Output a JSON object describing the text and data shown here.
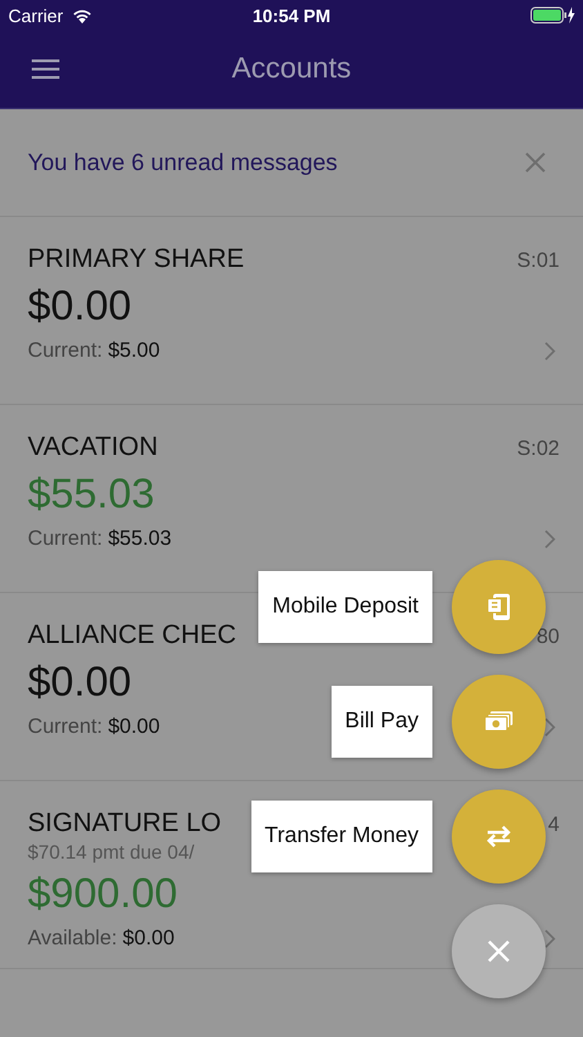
{
  "status_bar": {
    "carrier": "Carrier",
    "time": "10:54 PM"
  },
  "header": {
    "title": "Accounts"
  },
  "banner": {
    "text": "You have 6 unread messages"
  },
  "accounts": [
    {
      "name": "PRIMARY SHARE",
      "code": "S:01",
      "amount": "$0.00",
      "positive": false,
      "balance_label": "Current:",
      "balance_value": "$5.00"
    },
    {
      "name": "VACATION",
      "code": "S:02",
      "amount": "$55.03",
      "positive": true,
      "balance_label": "Current:",
      "balance_value": "$55.03"
    },
    {
      "name": "ALLIANCE CHEC",
      "code": "80",
      "amount": "$0.00",
      "positive": false,
      "balance_label": "Current:",
      "balance_value": "$0.00"
    },
    {
      "name": "SIGNATURE LO",
      "code": "4",
      "subtitle": "$70.14 pmt due 04/",
      "amount": "$900.00",
      "positive": true,
      "balance_label": "Available:",
      "balance_value": "$0.00"
    }
  ],
  "fab_menu": {
    "actions": [
      {
        "label": "Mobile Deposit",
        "kind": "deposit"
      },
      {
        "label": "Bill Pay",
        "kind": "bill"
      },
      {
        "label": "Transfer Money",
        "kind": "transfer"
      }
    ]
  }
}
